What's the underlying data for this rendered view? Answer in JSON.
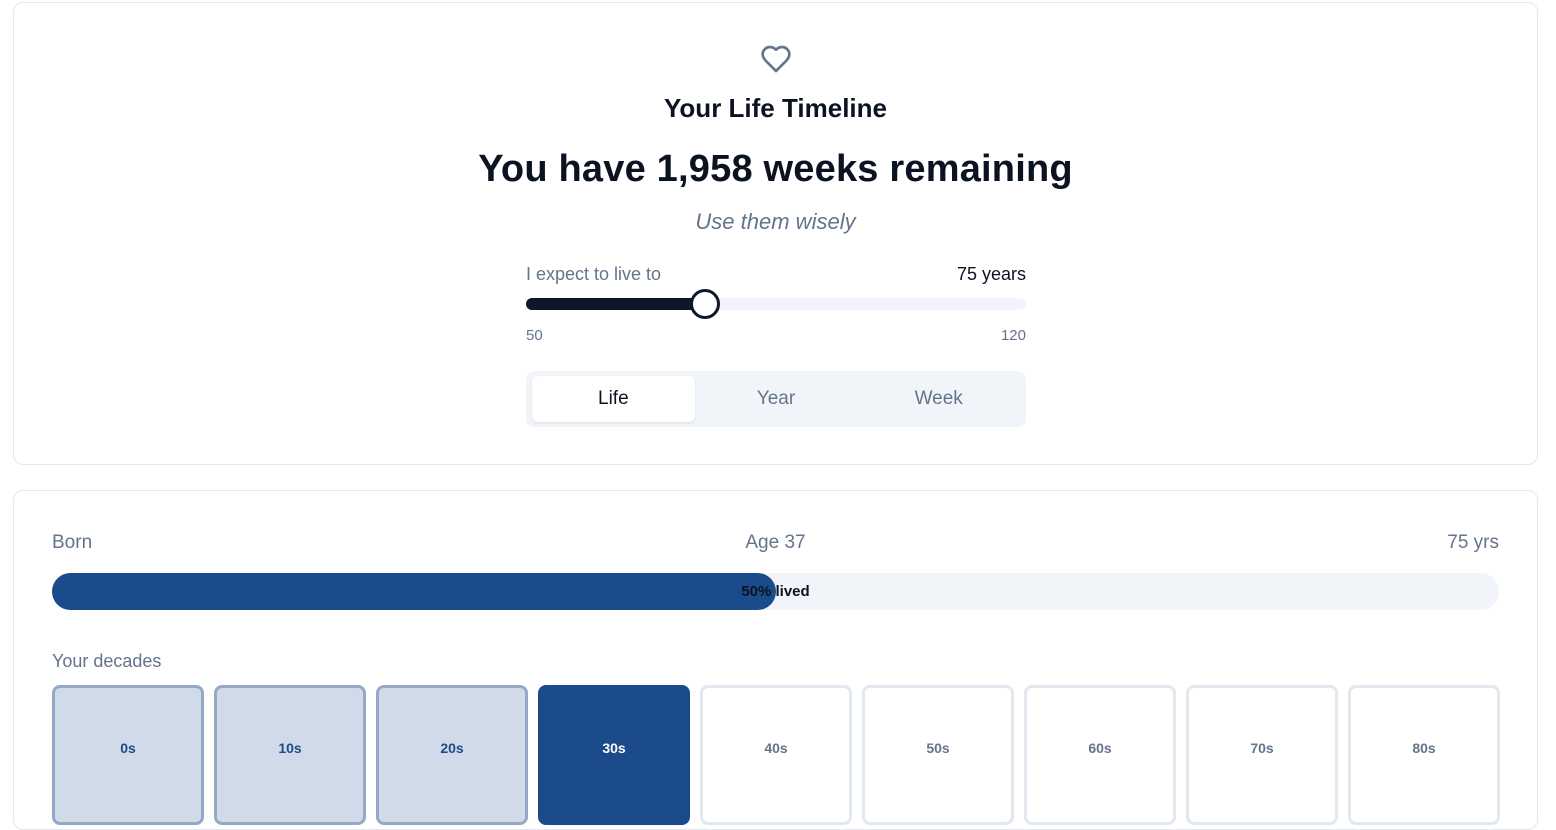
{
  "header": {
    "icon": "heart-icon",
    "title": "Your Life Timeline",
    "headline": "You have 1,958 weeks remaining",
    "subtitle": "Use them wisely"
  },
  "slider": {
    "label": "I expect to live to",
    "value_text": "75 years",
    "value": 75,
    "min": 50,
    "max": 120,
    "min_label": "50",
    "max_label": "120"
  },
  "tabs": [
    {
      "label": "Life",
      "active": true
    },
    {
      "label": "Year",
      "active": false
    },
    {
      "label": "Week",
      "active": false
    }
  ],
  "progress": {
    "start_label": "Born",
    "current_label": "Age 37",
    "end_label": "75 yrs",
    "fraction_lived": 0.5,
    "text": "50% lived"
  },
  "decades": {
    "label": "Your decades",
    "items": [
      {
        "label": "0s",
        "state": "lived"
      },
      {
        "label": "10s",
        "state": "lived"
      },
      {
        "label": "20s",
        "state": "lived"
      },
      {
        "label": "30s",
        "state": "current"
      },
      {
        "label": "40s",
        "state": "future"
      },
      {
        "label": "50s",
        "state": "future"
      },
      {
        "label": "60s",
        "state": "future"
      },
      {
        "label": "70s",
        "state": "future"
      },
      {
        "label": "80s",
        "state": "future"
      }
    ]
  },
  "colors": {
    "accent": "#1b4b8a",
    "dark": "#0f172a",
    "muted": "#64748b",
    "track": "#f1f5f9"
  }
}
